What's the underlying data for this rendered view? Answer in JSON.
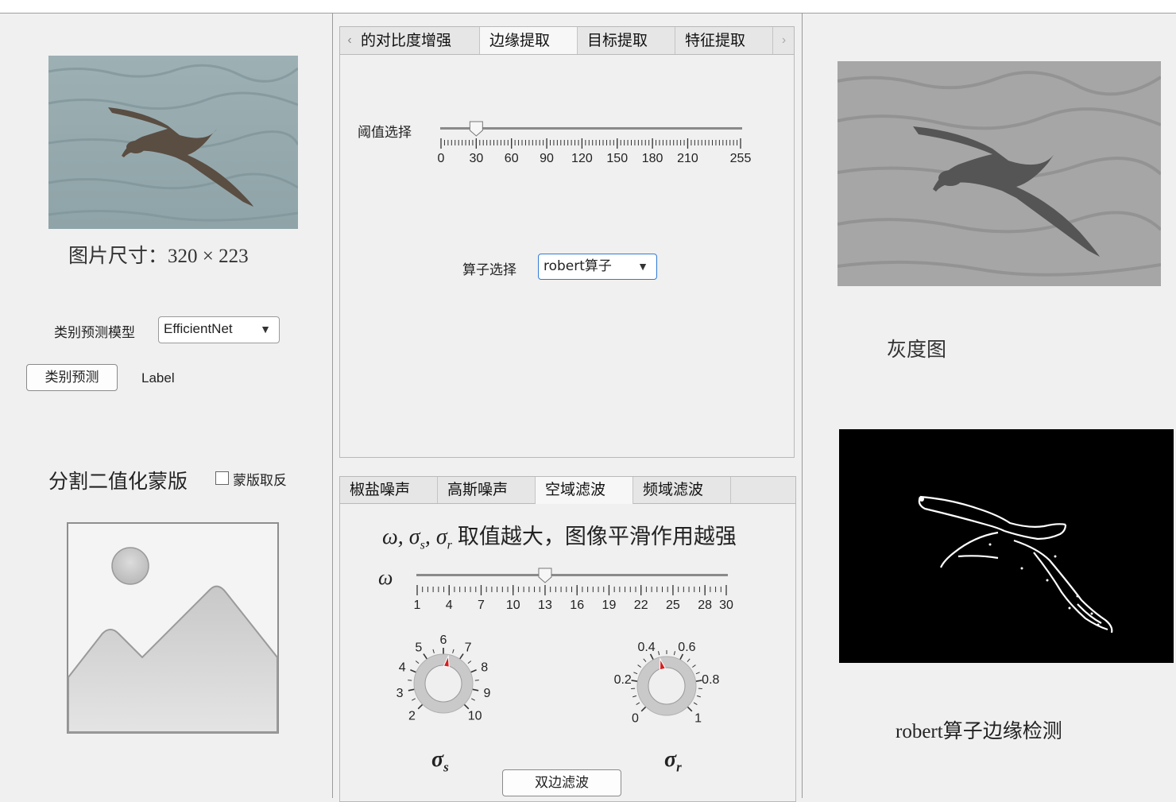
{
  "left": {
    "image_size_label": "图片尺寸：320 × 223",
    "model_label": "类别预测模型",
    "model_dropdown": "EfficientNet",
    "predict_button": "类别预测",
    "predict_result": "Label",
    "mask_title": "分割二值化蒙版",
    "invert_label": "蒙版取反"
  },
  "center_top": {
    "tabs": [
      "的对比度增强",
      "边缘提取",
      "目标提取",
      "特征提取"
    ],
    "active_tab": "边缘提取",
    "threshold_label": "阈值选择",
    "threshold_ticks": [
      "0",
      "30",
      "60",
      "90",
      "120",
      "150",
      "180",
      "210",
      "255"
    ],
    "threshold_value": 30,
    "operator_label": "算子选择",
    "operator_dropdown": "robert算子"
  },
  "center_bottom": {
    "tabs": [
      "椒盐噪声",
      "高斯噪声",
      "空域滤波",
      "频域滤波"
    ],
    "active_tab": "空域滤波",
    "hint_text": "取值越大，图像平滑作用越强",
    "omega_label": "ω",
    "omega_ticks": [
      "1",
      "4",
      "7",
      "10",
      "13",
      "16",
      "19",
      "22",
      "25",
      "28",
      "30"
    ],
    "omega_value": 13,
    "sigma_s_ticks": [
      "2",
      "3",
      "4",
      "5",
      "6",
      "7",
      "8",
      "9",
      "10"
    ],
    "sigma_s_value": 6.3,
    "sigma_r_ticks": [
      "0",
      "0.2",
      "0.4",
      "0.6",
      "0.8",
      "1"
    ],
    "sigma_r_value": 0.45,
    "sigma_s_label": "σs",
    "sigma_r_label": "σr",
    "bilateral_button": "双边滤波"
  },
  "right": {
    "gray_caption": "灰度图",
    "edge_caption": "robert算子边缘检测"
  },
  "colors": {
    "accent_blue": "#2f7bd6",
    "knob_pointer": "#d42020"
  }
}
